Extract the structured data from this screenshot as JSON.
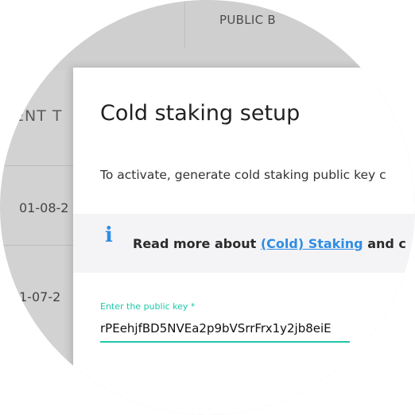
{
  "background": {
    "column_header": "PUBLIC B",
    "table_header": "ENT T",
    "rows": [
      "01-08-2",
      "1-07-2"
    ]
  },
  "dialog": {
    "title": "Cold staking setup",
    "description": "To activate, generate cold staking public key c",
    "info": {
      "icon": "info-icon",
      "text_before": "Read more about ",
      "link_text": "(Cold) Staking",
      "text_after": " and c"
    },
    "public_key_field": {
      "label": "Enter the public key *",
      "value": "rPEehjfBD5NVEa2p9bVSrrFrx1y2jb8eiE"
    }
  },
  "colors": {
    "accent": "#1fc7a8",
    "link": "#2f8de4"
  }
}
